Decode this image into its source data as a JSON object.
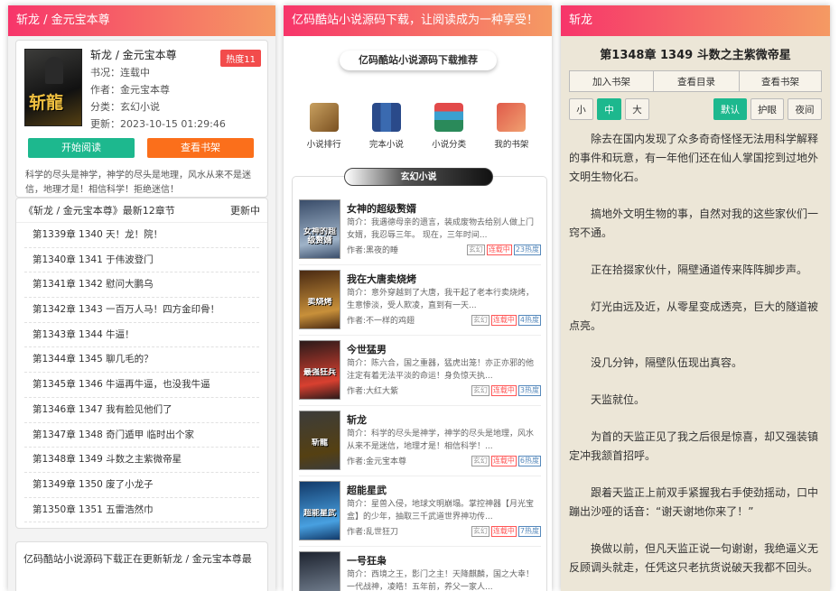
{
  "panel1": {
    "header": "斩龙 / 金元宝本尊",
    "book": {
      "title": "斩龙 / 金元宝本尊",
      "status": "书况：连载中",
      "author": "作者：金元宝本尊",
      "category": "分类：玄幻小说",
      "updated": "更新：2023-10-15 01:29:46",
      "hot": "热度11",
      "cover_text": "斩龍"
    },
    "buttons": {
      "read": "开始阅读",
      "shelf": "查看书架"
    },
    "description": "科学的尽头是神学，神学的尽头是地理，风水从来不是迷信，地理才是！相信科学！拒绝迷信！",
    "chapters_header": "《斩龙 / 金元宝本尊》最新12章节",
    "chapters_more": "更新中",
    "chapters": [
      "第1339章 1340 天！龙！院！",
      "第1340章 1341 于伟波登门",
      "第1341章 1342 慰问大鹏乌",
      "第1342章 1343 一百万人马！四方金印骨！",
      "第1343章 1344 牛逼！",
      "第1344章 1345 聊几毛的？",
      "第1345章 1346 牛逼再牛逼，也没我牛逼",
      "第1346章 1347 我有脸见他们了",
      "第1347章 1348 奇门遁甲 临时出个家",
      "第1348章 1349 斗数之主紫微帝星",
      "第1349章 1350 废了小龙子",
      "第1350章 1351 五雷浩然巾"
    ],
    "news": "亿码酷站小说源码下载正在更新斩龙 / 金元宝本尊最"
  },
  "panel2": {
    "header": "亿码酷站小说源码下载，让阅读成为一种享受！",
    "title": "亿码酷站小说源码下载推荐",
    "nav": [
      {
        "label": "小说排行",
        "icon": "scroll-quill-icon"
      },
      {
        "label": "完本小说",
        "icon": "books-icon"
      },
      {
        "label": "小说分类",
        "icon": "stacked-books-icon"
      },
      {
        "label": "我的书架",
        "icon": "bookmark-book-icon"
      }
    ],
    "genre": "玄幻小说",
    "items": [
      {
        "name": "女神的超级赘婿",
        "desc": "简介：我遇德母亲的遗言，装成废物去给别人做上门女婿，我忍辱三年。 现在，三年时间...",
        "author": "作者:黑夜的睡",
        "tags": [
          "玄幻",
          "连载中",
          "23热度"
        ],
        "cover": [
          "#3a4d6a",
          "#9fb3c8"
        ],
        "cover_text": "女神的超级赘婿"
      },
      {
        "name": "我在大唐卖烧烤",
        "desc": "简介：意外穿越到了大唐，我干起了老本行卖烧烤，生意惨淡，受人欺凌，直到有一天...",
        "author": "作者:不一样的鸡翅",
        "tags": [
          "玄幻",
          "连载中",
          "4热度"
        ],
        "cover": [
          "#4a2a12",
          "#c8903a"
        ],
        "cover_text": "卖烧烤"
      },
      {
        "name": "今世猛男",
        "desc": "简介：陈六合，国之重器，猛虎出笼！亦正亦邪的他注定有着无法平淡的命运！身负惊天执...",
        "author": "作者:大红大紫",
        "tags": [
          "玄幻",
          "连载中",
          "3热度"
        ],
        "cover": [
          "#2b1a1a",
          "#d84030"
        ],
        "cover_text": "最强狂兵"
      },
      {
        "name": "斩龙",
        "desc": "简介：科学的尽头是神学，神学的尽头是地理，风水从来不是迷信，地理才是！相信科学！...",
        "author": "作者:金元宝本尊",
        "tags": [
          "玄幻",
          "连载中",
          "6热度"
        ],
        "cover": [
          "#3c3c3a",
          "#554012"
        ],
        "cover_text": "斩龍"
      },
      {
        "name": "超能星武",
        "desc": "简介：星兽入侵，地球文明崩塌。掌控神器【月光宝盒】的少年，抽取三千武道世界神功传...",
        "author": "作者:乱世狂刀",
        "tags": [
          "玄幻",
          "连载中",
          "7热度"
        ],
        "cover": [
          "#123a6a",
          "#48a0e0"
        ],
        "cover_text": "超能星武"
      },
      {
        "name": "一号狂枭",
        "desc": "简介：西境之王，影门之主！天降麒麟，国之大幸！一代战神，凌皓！五年前，养父一家人...",
        "author": "",
        "tags": [],
        "cover": [
          "#1e2430",
          "#6e7a8a"
        ],
        "cover_text": ""
      }
    ]
  },
  "panel3": {
    "header": "斩龙",
    "title": "第1348章 1349 斗数之主紫微帝星",
    "toolbar": [
      "加入书架",
      "查看目录",
      "查看书架"
    ],
    "sizes": [
      "小",
      "中",
      "大"
    ],
    "themes": [
      "默认",
      "护眼",
      "夜间"
    ],
    "paragraphs": [
      "除去在国内发现了众多奇奇怪怪无法用科学解释的事件和玩意，有一年他们还在仙人掌国挖到过地外文明生物化石。",
      "搞地外文明生物的事，自然对我的这些家伙们一窍不通。",
      "正在拾掇家伙什，隔壁通道传来阵阵脚步声。",
      "灯光由远及近，从零星变成透亮，巨大的隧道被点亮。",
      "没几分钟，隔壁队伍现出真容。",
      "天监就位。",
      "为首的天监正见了我之后很是惊喜，却又强装镇定冲我颔首招呼。",
      "跟着天监正上前双手紧握我右手使劲摇动，口中蹦出沙哑的话音：“谢天谢地你来了！”",
      "换做以前，但凡天监正说一句谢谢，我绝逼义无反顾调头就走，任凭这只老抗货说破天我都不回头。"
    ]
  }
}
